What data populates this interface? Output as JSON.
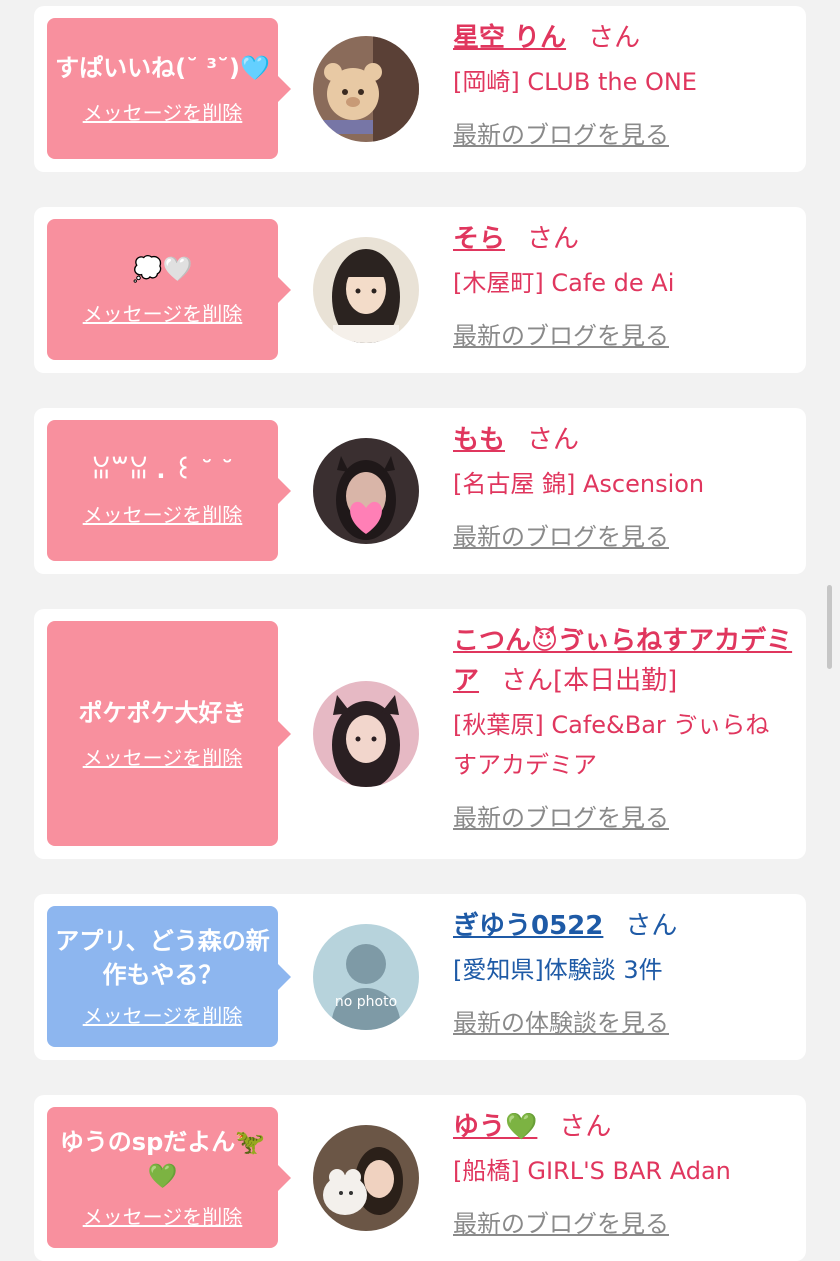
{
  "cards": [
    {
      "message": "すぱいいね(˘ ³˘)🩵",
      "delete_label": "メッセージを削除",
      "name": "星空 りん",
      "honorific": "さん",
      "shop": "[岡崎] CLUB the ONE",
      "blog_link": "最新のブログを見る",
      "avatar_icon": "bear-sticker-avatar"
    },
    {
      "message": "💭🤍",
      "delete_label": "メッセージを削除",
      "name": "そら",
      "honorific": "さん",
      "shop": "[木屋町] Cafe de Ai",
      "blog_link": "最新のブログを見る",
      "avatar_icon": "profile-photo"
    },
    {
      "message": "ꈍ꒳ꈍ . ꒰ ˘ ˘",
      "delete_label": "メッセージを削除",
      "name": "もも",
      "honorific": "さん",
      "shop": "[名古屋 錦] Ascension",
      "blog_link": "最新のブログを見る",
      "avatar_icon": "heart-cover-avatar"
    },
    {
      "message": "ポケポケ大好き",
      "delete_label": "メッセージを削除",
      "name": "こつん😈ゔぃらねすアカデミア",
      "honorific": "さん",
      "extra": "[本日出勤]",
      "shop": "[秋葉原] Cafe&Bar ゔぃらねすアカデミア",
      "blog_link": "最新のブログを見る",
      "avatar_icon": "cat-ears-avatar"
    },
    {
      "message": "アプリ、どう森の新作もやる？",
      "delete_label": "メッセージを削除",
      "name": "ぎゆう0522",
      "honorific": "さん",
      "shop": "[愛知県]体験談 3件",
      "blog_link": "最新の体験談を見る",
      "avatar_icon": "no-photo-placeholder",
      "avatar_text": "no photo"
    },
    {
      "message": "ゆうのspだよん🦖💚",
      "delete_label": "メッセージを削除",
      "name": "ゆう💚",
      "honorific": "さん",
      "shop": "[船橋] GIRL'S BAR Adan",
      "blog_link": "最新のブログを見る",
      "avatar_icon": "plush-avatar"
    }
  ],
  "colors": {
    "pink_bubble": "#f8909e",
    "blue_bubble": "#8db6ef",
    "name_pink": "#e0365e",
    "name_blue": "#1e5aa6",
    "link_gray": "#8a8a8a"
  }
}
